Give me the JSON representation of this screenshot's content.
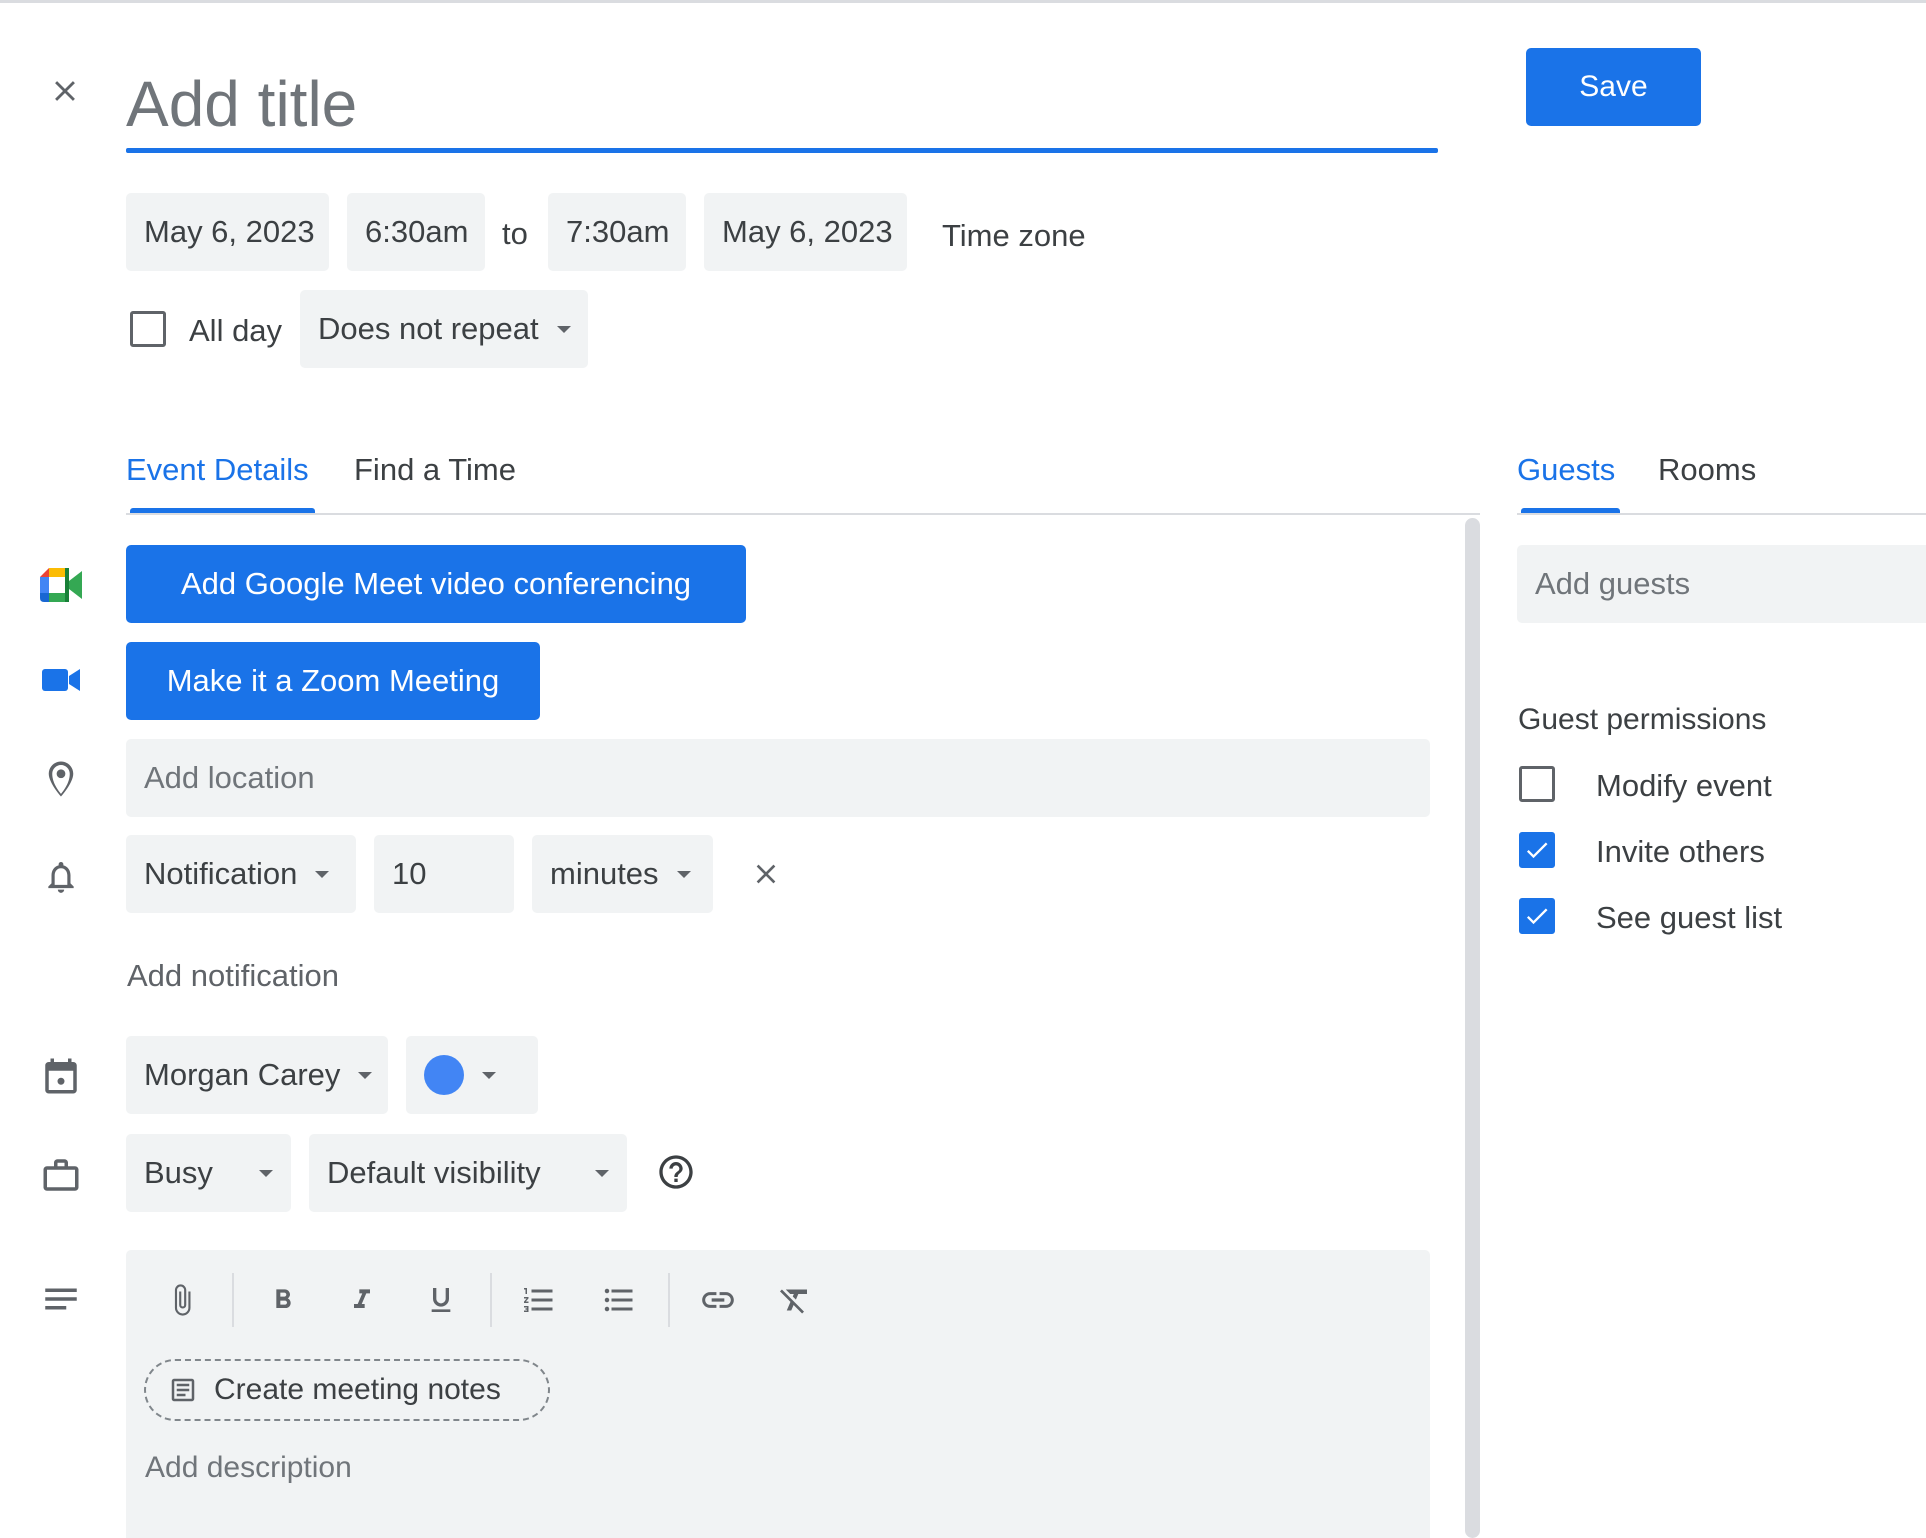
{
  "header": {
    "title_placeholder": "Add title",
    "save_label": "Save"
  },
  "datetime": {
    "start_date": "May 6, 2023",
    "start_time": "6:30am",
    "separator": "to",
    "end_time": "7:30am",
    "end_date": "May 6, 2023",
    "timezone_label": "Time zone",
    "all_day_label": "All day",
    "all_day_checked": false,
    "repeat_label": "Does not repeat"
  },
  "tabs": [
    {
      "label": "Event Details",
      "active": true
    },
    {
      "label": "Find a Time",
      "active": false
    }
  ],
  "side_tabs": [
    {
      "label": "Guests",
      "active": true
    },
    {
      "label": "Rooms",
      "active": false
    }
  ],
  "details": {
    "meet_button": "Add Google Meet video conferencing",
    "zoom_button": "Make it a Zoom Meeting",
    "location_placeholder": "Add location",
    "notification": {
      "type": "Notification",
      "amount": "10",
      "unit": "minutes"
    },
    "add_notification": "Add notification",
    "calendar_owner": "Morgan Carey",
    "calendar_color": "#4285f4",
    "availability": "Busy",
    "visibility": "Default visibility",
    "description": {
      "create_notes": "Create meeting notes",
      "placeholder": "Add description"
    }
  },
  "guests": {
    "add_placeholder": "Add guests",
    "permissions_title": "Guest permissions",
    "permissions": [
      {
        "label": "Modify event",
        "checked": false
      },
      {
        "label": "Invite others",
        "checked": true
      },
      {
        "label": "See guest list",
        "checked": true
      }
    ]
  },
  "colors": {
    "accent": "#1a73e8",
    "field_bg": "#f1f3f4"
  }
}
